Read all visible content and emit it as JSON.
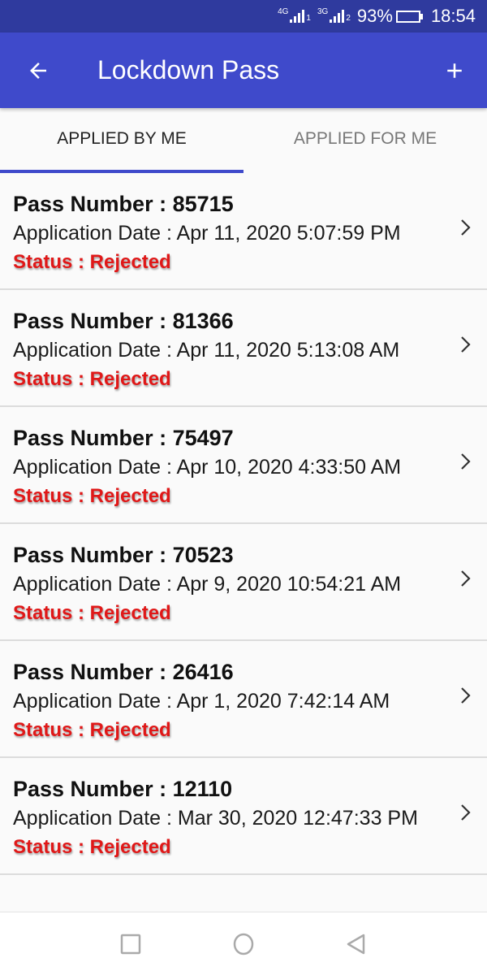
{
  "status_bar": {
    "network_1": "4G",
    "sim_1": "1",
    "network_2": "3G",
    "sim_2": "2",
    "battery_percent": "93%",
    "battery_level": 0.93,
    "time": "18:54"
  },
  "app_bar": {
    "back_icon": "arrow-left-icon",
    "title": "Lockdown Pass",
    "add_icon": "plus-icon",
    "background_color": "#3f4acb"
  },
  "tabs": [
    {
      "label": "APPLIED BY ME",
      "active": true
    },
    {
      "label": "APPLIED FOR ME",
      "active": false
    }
  ],
  "passes": [
    {
      "pass_number": "Pass Number : 85715",
      "application_date": "Application Date : Apr 11, 2020 5:07:59 PM",
      "status": "Status : Rejected"
    },
    {
      "pass_number": "Pass Number : 81366",
      "application_date": "Application Date : Apr 11, 2020 5:13:08 AM",
      "status": "Status : Rejected"
    },
    {
      "pass_number": "Pass Number : 75497",
      "application_date": "Application Date : Apr 10, 2020 4:33:50 AM",
      "status": "Status : Rejected"
    },
    {
      "pass_number": "Pass Number : 70523",
      "application_date": "Application Date : Apr 9, 2020 10:54:21 AM",
      "status": "Status : Rejected"
    },
    {
      "pass_number": "Pass Number : 26416",
      "application_date": "Application Date : Apr 1, 2020 7:42:14 AM",
      "status": "Status : Rejected"
    },
    {
      "pass_number": "Pass Number : 12110",
      "application_date": "Application Date : Mar 30, 2020 12:47:33 PM",
      "status": "Status : Rejected"
    }
  ],
  "colors": {
    "status_rejected": "#e01818",
    "accent": "#3f4acb",
    "status_bar": "#2f3a9e"
  },
  "nav_bar": {
    "buttons": [
      "recents-icon",
      "home-icon",
      "back-icon"
    ]
  }
}
